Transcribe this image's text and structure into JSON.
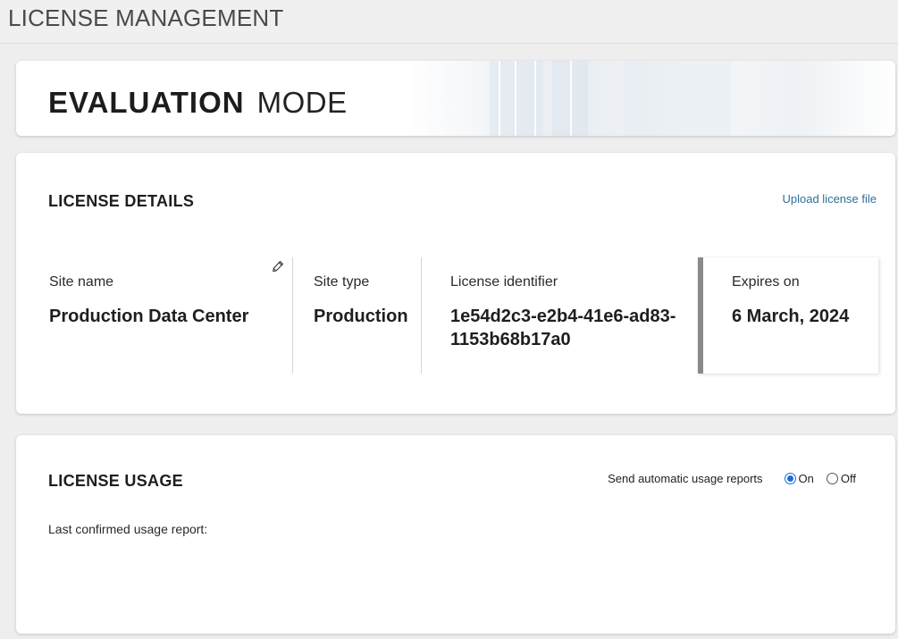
{
  "header": {
    "title": "LICENSE MANAGEMENT"
  },
  "mode": {
    "bold_word": "EVALUATION",
    "light_word": "MODE"
  },
  "details": {
    "section_title": "LICENSE DETAILS",
    "upload_link": "Upload license file",
    "site_name": {
      "label": "Site name",
      "value": "Production Data Center"
    },
    "site_type": {
      "label": "Site type",
      "value": "Production"
    },
    "license_identifier": {
      "label": "License identifier",
      "value_line1": "1e54d2c3-e2b4-41e6-ad83-",
      "value_line2": "1153b68b17a0"
    },
    "expires_on": {
      "label": "Expires on",
      "value": "6 March, 2024"
    },
    "edit_icon": "pencil-icon"
  },
  "usage": {
    "section_title": "LICENSE USAGE",
    "toggle_label": "Send automatic usage reports",
    "option_on": "On",
    "option_off": "Off",
    "selected": "On",
    "last_report_label": "Last confirmed usage report:"
  },
  "colors": {
    "link": "#2f6f9a",
    "radio_selected": "#1a6fd6",
    "expires_accent": "#8a8a8a"
  }
}
